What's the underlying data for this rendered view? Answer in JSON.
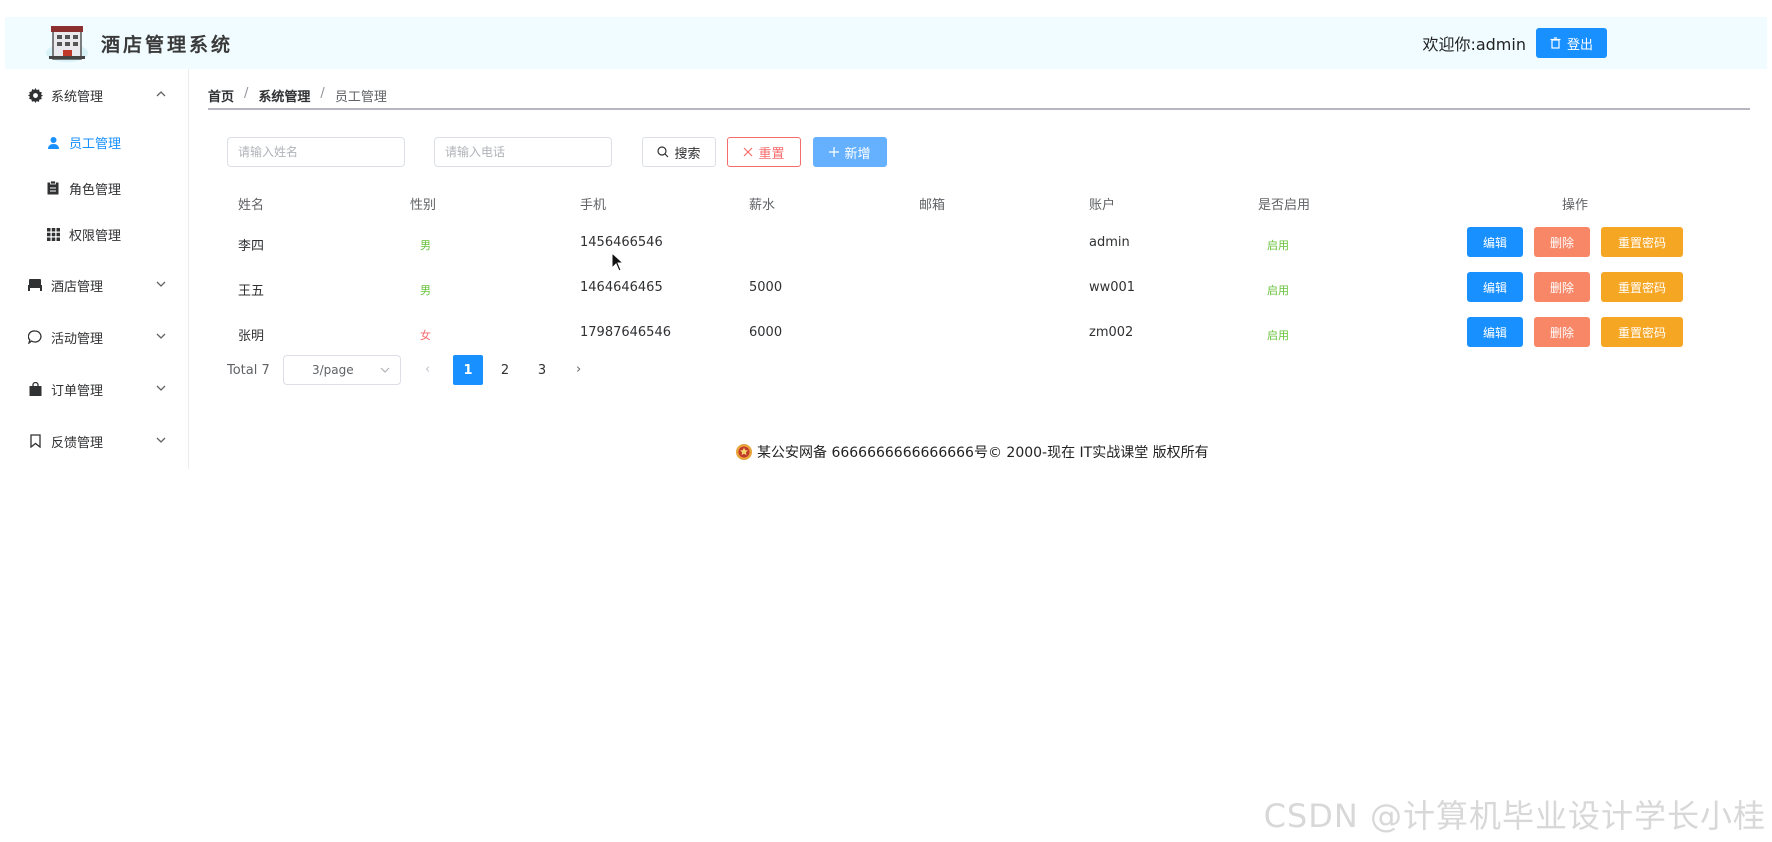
{
  "header": {
    "title": "酒店管理系统",
    "welcome": "欢迎你:admin",
    "logout_label": "登出"
  },
  "sidebar": {
    "groups": [
      {
        "label": "系统管理",
        "icon": "gear-icon",
        "expanded": true,
        "items": [
          {
            "label": "员工管理",
            "icon": "user-icon",
            "active": true
          },
          {
            "label": "角色管理",
            "icon": "clipboard-icon",
            "active": false
          },
          {
            "label": "权限管理",
            "icon": "grid-icon",
            "active": false
          }
        ]
      },
      {
        "label": "酒店管理",
        "icon": "bed-icon",
        "expanded": false
      },
      {
        "label": "活动管理",
        "icon": "chat-bubble-icon",
        "expanded": false
      },
      {
        "label": "订单管理",
        "icon": "shopping-bag-icon",
        "expanded": false
      },
      {
        "label": "反馈管理",
        "icon": "bookmark-icon",
        "expanded": false
      }
    ]
  },
  "breadcrumb": [
    "首页",
    "系统管理",
    "员工管理"
  ],
  "toolbar": {
    "name_placeholder": "请输入姓名",
    "phone_placeholder": "请输入电话",
    "search_label": "搜索",
    "reset_label": "重置",
    "add_label": "新增"
  },
  "table": {
    "columns": [
      "姓名",
      "性别",
      "手机",
      "薪水",
      "邮箱",
      "账户",
      "是否启用",
      "操作"
    ],
    "rows": [
      {
        "name": "李四",
        "gender": "男",
        "phone": "1456466546",
        "salary": "",
        "email": "",
        "account": "admin",
        "status": "启用"
      },
      {
        "name": "王五",
        "gender": "男",
        "phone": "1464646465",
        "salary": "5000",
        "email": "",
        "account": "ww001",
        "status": "启用"
      },
      {
        "name": "张明",
        "gender": "女",
        "phone": "17987646546",
        "salary": "6000",
        "email": "",
        "account": "zm002",
        "status": "启用"
      }
    ],
    "actions": {
      "edit": "编辑",
      "delete": "删除",
      "reset_password": "重置密码"
    }
  },
  "pagination": {
    "total": "Total 7",
    "page_size": "3/page",
    "pages": [
      "1",
      "2",
      "3"
    ],
    "current": "1",
    "prev": "‹",
    "next": "›"
  },
  "footer": {
    "text": "某公安网备 6666666666666666号© 2000-现在 IT实战课堂 版权所有"
  },
  "watermark": "CSDN @计算机毕业设计学长小桂",
  "colors": {
    "primary": "#1890ff",
    "danger": "#f78767",
    "warning": "#f5a623",
    "success": "#67c23a",
    "header_bg": "#f0fcff"
  }
}
